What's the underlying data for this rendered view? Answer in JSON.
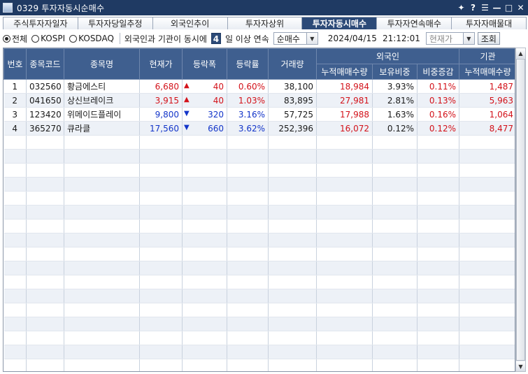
{
  "window": {
    "title": "0329 투자자동시순매수",
    "controls": [
      "pin-icon",
      "help-icon",
      "menu-icon",
      "minimize-icon",
      "maximize-icon",
      "close-icon"
    ],
    "help_glyph": "?",
    "menu_glyph": "☰",
    "min_glyph": "—",
    "max_glyph": "□",
    "close_glyph": "✕",
    "pin_glyph": "✦"
  },
  "tabs": [
    {
      "label": "주식투자자일자",
      "active": false
    },
    {
      "label": "투자자당일추정",
      "active": false
    },
    {
      "label": "외국인추이",
      "active": false
    },
    {
      "label": "투자자상위",
      "active": false
    },
    {
      "label": "투자자동시매수",
      "active": true
    },
    {
      "label": "투자자연속매수",
      "active": false
    },
    {
      "label": "투자자매물대",
      "active": false
    }
  ],
  "filters": {
    "market_options": [
      {
        "label": "전체",
        "selected": true
      },
      {
        "label": "KOSPI",
        "selected": false
      },
      {
        "label": "KOSDAQ",
        "selected": false
      }
    ],
    "condition_prefix": "외국인과 기관이 동시에",
    "days_value": "4",
    "condition_suffix": "일 이상 연속",
    "trade_type": "순매수",
    "date": "2024/04/15",
    "time": "21:12:01",
    "price_basis": "현재가",
    "query_label": "조회"
  },
  "table": {
    "headers": {
      "no": "번호",
      "code": "종목코드",
      "name": "종목명",
      "price": "현재가",
      "change": "등락폭",
      "rate": "등락률",
      "volume": "거래량",
      "foreign_group": "외국인",
      "foreign_cum": "누적매매수량",
      "foreign_hold": "보유비중",
      "foreign_delta": "비중증감",
      "inst_group": "기관",
      "inst_cum": "누적매매수량"
    },
    "rows": [
      {
        "no": "1",
        "code": "032560",
        "name": "황금에스티",
        "price": "6,680",
        "dir": "up",
        "change": "40",
        "rate": "0.60%",
        "volume": "38,100",
        "f_cum": "18,984",
        "f_hold": "3.93%",
        "f_delta": "0.11%",
        "i_cum": "1,487"
      },
      {
        "no": "2",
        "code": "041650",
        "name": "상신브레이크",
        "price": "3,915",
        "dir": "up",
        "change": "40",
        "rate": "1.03%",
        "volume": "83,895",
        "f_cum": "27,981",
        "f_hold": "2.81%",
        "f_delta": "0.13%",
        "i_cum": "5,963"
      },
      {
        "no": "3",
        "code": "123420",
        "name": "위메이드플레이",
        "price": "9,800",
        "dir": "down",
        "change": "320",
        "rate": "3.16%",
        "volume": "57,725",
        "f_cum": "17,988",
        "f_hold": "1.63%",
        "f_delta": "0.16%",
        "i_cum": "1,064"
      },
      {
        "no": "4",
        "code": "365270",
        "name": "큐라클",
        "price": "17,560",
        "dir": "down",
        "change": "660",
        "rate": "3.62%",
        "volume": "252,396",
        "f_cum": "16,072",
        "f_hold": "0.12%",
        "f_delta": "0.12%",
        "i_cum": "8,477"
      }
    ],
    "up_glyph": "▲",
    "down_glyph": "▼",
    "colors": {
      "up": "#d3121a",
      "down": "#1335c9",
      "header_bg": "#3f5f8f",
      "active_tab": "#2c4a78"
    }
  }
}
